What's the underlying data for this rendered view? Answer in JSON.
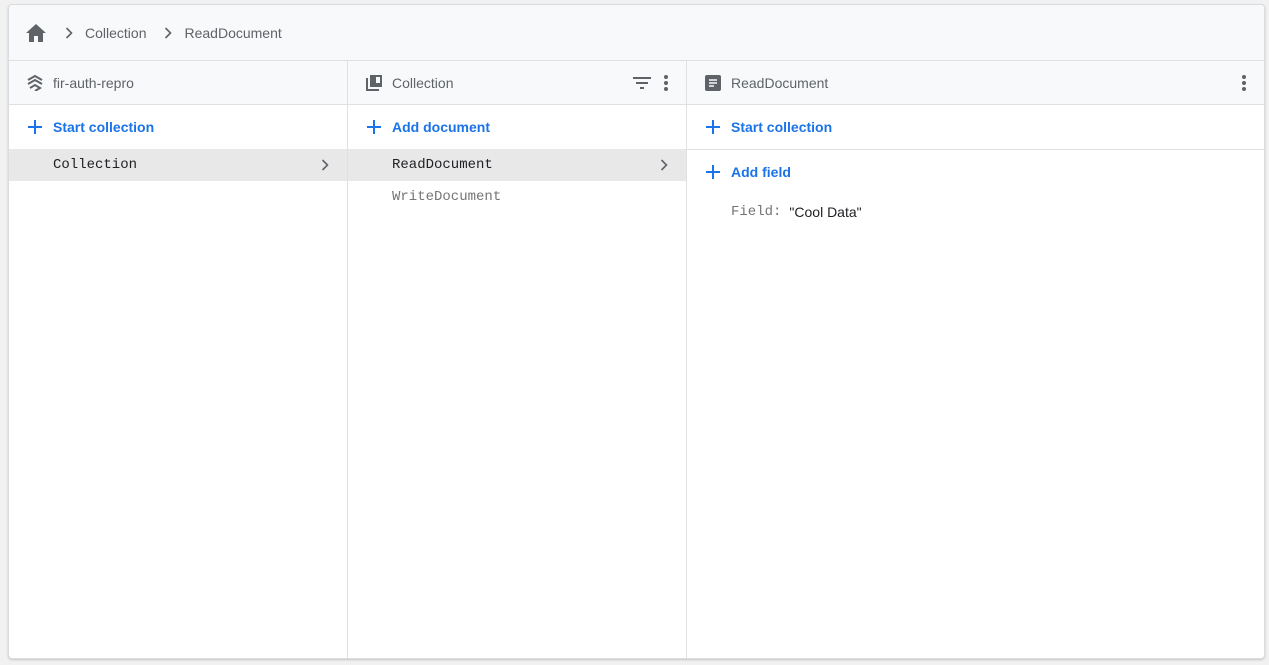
{
  "breadcrumb": {
    "items": [
      {
        "label": "Collection"
      },
      {
        "label": "ReadDocument"
      }
    ]
  },
  "panels": {
    "root": {
      "title": "fir-auth-repro",
      "action_label": "Start collection",
      "items": [
        {
          "label": "Collection",
          "selected": true
        }
      ]
    },
    "collection": {
      "title": "Collection",
      "action_label": "Add document",
      "items": [
        {
          "label": "ReadDocument",
          "selected": true
        },
        {
          "label": "WriteDocument",
          "selected": false
        }
      ]
    },
    "document": {
      "title": "ReadDocument",
      "start_collection_label": "Start collection",
      "add_field_label": "Add field",
      "fields": [
        {
          "key": "Field:",
          "value": "\"Cool Data\""
        }
      ]
    }
  },
  "colors": {
    "accent": "#1a73e8",
    "selected_bg": "#e8e8e8",
    "header_bg": "#f8f9fa"
  }
}
